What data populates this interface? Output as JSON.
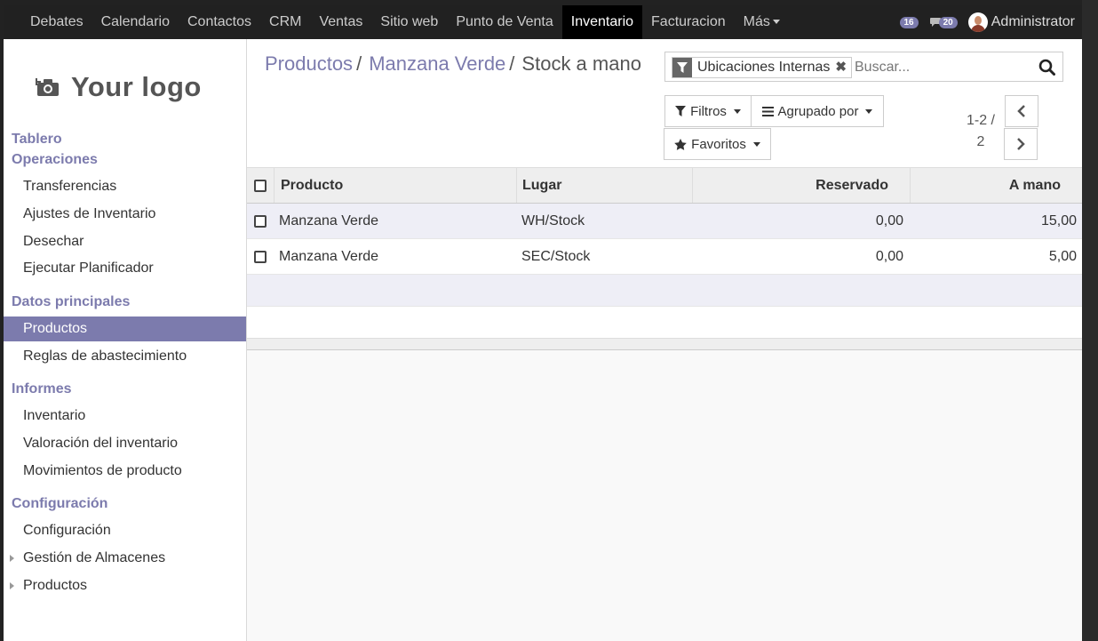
{
  "topbar": {
    "menu": [
      {
        "label": "Debates"
      },
      {
        "label": "Calendario"
      },
      {
        "label": "Contactos"
      },
      {
        "label": "CRM"
      },
      {
        "label": "Ventas"
      },
      {
        "label": "Sitio web"
      },
      {
        "label": "Punto de Venta"
      },
      {
        "label": "Inventario",
        "active": true
      },
      {
        "label": "Facturacion"
      },
      {
        "label": "Más"
      }
    ],
    "activities_count": "16",
    "messages_count": "20",
    "user_name": "Administrator"
  },
  "sidebar": {
    "logo_text": "Your logo",
    "sections": {
      "tablero": "Tablero",
      "operaciones": "Operaciones",
      "datos": "Datos principales",
      "informes": "Informes",
      "configuracion": "Configuración"
    },
    "items": {
      "transferencias": "Transferencias",
      "ajustes": "Ajustes de Inventario",
      "desechar": "Desechar",
      "planificador": "Ejecutar Planificador",
      "productos": "Productos",
      "reglas": "Reglas de abastecimiento",
      "inventario": "Inventario",
      "valoracion": "Valoración del inventario",
      "movimientos": "Movimientos de producto",
      "config": "Configuración",
      "almacenes": "Gestión de Almacenes",
      "productos_cfg": "Productos"
    },
    "active_item": "Productos"
  },
  "breadcrumb": {
    "level1": "Productos",
    "level2": "Manzana Verde",
    "current": "Stock a mano"
  },
  "search": {
    "facet_value": "Ubicaciones Internas",
    "placeholder": "Buscar..."
  },
  "buttons": {
    "filters": "Filtros",
    "group_by": "Agrupado por",
    "favorites": "Favoritos"
  },
  "pager": {
    "range": "1-2 /",
    "total": "2"
  },
  "table": {
    "columns": {
      "product": "Producto",
      "location": "Lugar",
      "reserved": "Reservado",
      "on_hand": "A mano"
    },
    "rows": [
      {
        "product": "Manzana Verde",
        "location": "WH/Stock",
        "reserved": "0,00",
        "on_hand": "15,00"
      },
      {
        "product": "Manzana Verde",
        "location": "SEC/Stock",
        "reserved": "0,00",
        "on_hand": "5,00"
      }
    ]
  },
  "colors": {
    "brand": "#7c7bad",
    "topbar": "#212121",
    "active_menu": "#000000"
  }
}
